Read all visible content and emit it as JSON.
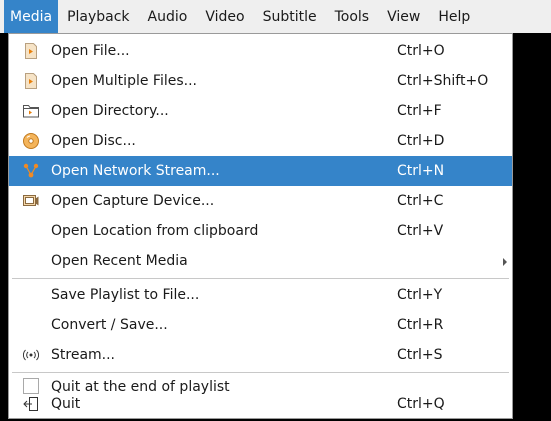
{
  "menubar": {
    "items": [
      {
        "label": "Media",
        "active": true
      },
      {
        "label": "Playback"
      },
      {
        "label": "Audio"
      },
      {
        "label": "Video"
      },
      {
        "label": "Subtitle"
      },
      {
        "label": "Tools"
      },
      {
        "label": "View"
      },
      {
        "label": "Help"
      }
    ]
  },
  "menu": {
    "items": [
      {
        "label": "Open File...",
        "shortcut": "Ctrl+O",
        "icon": "file-icon"
      },
      {
        "label": "Open Multiple Files...",
        "shortcut": "Ctrl+Shift+O",
        "icon": "file-icon"
      },
      {
        "label": "Open Directory...",
        "shortcut": "Ctrl+F",
        "icon": "folder-icon"
      },
      {
        "label": "Open Disc...",
        "shortcut": "Ctrl+D",
        "icon": "disc-icon"
      },
      {
        "label": "Open Network Stream...",
        "shortcut": "Ctrl+N",
        "icon": "network-icon",
        "highlighted": true
      },
      {
        "label": "Open Capture Device...",
        "shortcut": "Ctrl+C",
        "icon": "capture-device-icon"
      },
      {
        "label": "Open Location from clipboard",
        "shortcut": "Ctrl+V"
      },
      {
        "label": "Open Recent Media",
        "shortcut": "",
        "submenu": true
      },
      {
        "label": "Save Playlist to File...",
        "shortcut": "Ctrl+Y"
      },
      {
        "label": "Convert / Save...",
        "shortcut": "Ctrl+R"
      },
      {
        "label": "Stream...",
        "shortcut": "Ctrl+S",
        "icon": "stream-icon"
      },
      {
        "label": "Quit at the end of playlist",
        "shortcut": "",
        "checkbox": true,
        "checked": false
      },
      {
        "label": "Quit",
        "shortcut": "Ctrl+Q",
        "icon": "quit-icon"
      }
    ]
  },
  "colors": {
    "highlight": "#3584c9",
    "menubar_bg": "#efefef",
    "menu_bg": "#ffffff",
    "background": "#000000"
  }
}
